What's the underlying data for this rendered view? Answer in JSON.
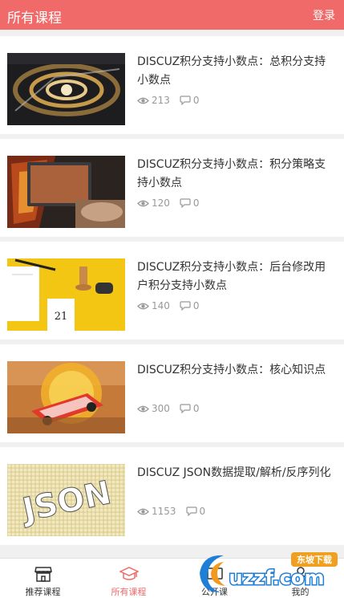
{
  "header": {
    "title": "所有课程",
    "login_label": "登录"
  },
  "courses": [
    {
      "title": "DISCUZ积分支持小数点：总积分支持小数点",
      "views": "213",
      "comments": "0"
    },
    {
      "title": "DISCUZ积分支持小数点：积分策略支持小数点",
      "views": "120",
      "comments": "0"
    },
    {
      "title": "DISCUZ积分支持小数点：后台修改用户积分支持小数点",
      "views": "140",
      "comments": "0"
    },
    {
      "title": "DISCUZ积分支持小数点：核心知识点",
      "views": "300",
      "comments": "0"
    },
    {
      "title": "DISCUZ JSON数据提取/解析/反序列化",
      "views": "1153",
      "comments": "0"
    }
  ],
  "tabs": [
    {
      "label": "推荐课程",
      "icon": "store-icon"
    },
    {
      "label": "所有课程",
      "icon": "graduation-cap-icon"
    },
    {
      "label": "公开课",
      "icon": "open-class-icon"
    },
    {
      "label": "我的",
      "icon": "user-icon"
    }
  ],
  "active_tab": "所有课程",
  "thumbnail_text": {
    "course3": "21",
    "course5": "JSON"
  },
  "watermark": {
    "brand": "uzzf.com",
    "badge": "东坡下载"
  },
  "colors": {
    "accent": "#f06a6a",
    "text": "#333333",
    "muted": "#999999"
  }
}
